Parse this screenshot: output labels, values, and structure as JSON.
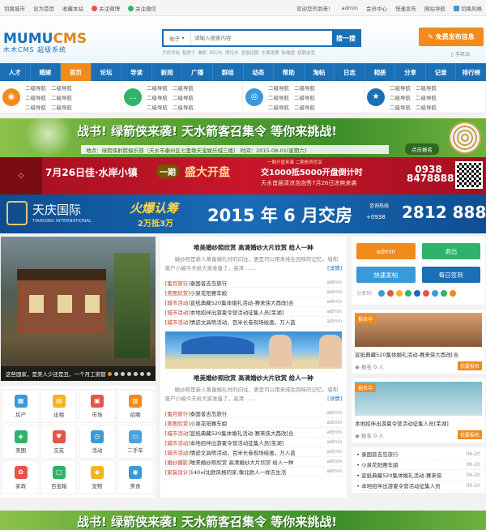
{
  "topbar": {
    "left": [
      "切换城市",
      "设为首页",
      "收藏本站",
      "关注微博",
      "关注微信"
    ],
    "right": [
      "欢迎您的到来！",
      "admin",
      "会员中心",
      "快速发布",
      "网站导航",
      "切换风格"
    ]
  },
  "logo": {
    "line1a": "MUMU",
    "line1b": "CMS",
    "line2": "木木CMS 超级系统"
  },
  "search": {
    "select": "帖子",
    "placeholder": "请输入搜索内容",
    "button": "搜一搜",
    "hotwords": [
      "手机号码",
      "租房子",
      "兼职",
      "四行车",
      "摩托车",
      "急售招聘",
      "车票退票",
      "新楼盘",
      "招聘信息"
    ]
  },
  "publish": {
    "button": "免费发布信息",
    "mobile": "手机站"
  },
  "nav": [
    "人才",
    "婚嫁",
    "首页",
    "论坛",
    "导读",
    "新闻",
    "广播",
    "群组",
    "动态",
    "帮助",
    "淘帖",
    "日志",
    "相册",
    "分享",
    "记录",
    "排行榜"
  ],
  "nav_active": "首页",
  "cats": [
    {
      "icon": "map-pin-icon",
      "color": "#f08b1c",
      "glyph": "◉",
      "links": [
        "二级导航",
        "二级导航",
        "二级导航",
        "二级导航",
        "二级导航",
        "二级导航"
      ]
    },
    {
      "icon": "chat-icon",
      "color": "#2fb36b",
      "glyph": "…",
      "links": [
        "二级导航",
        "二级导航",
        "二级导航",
        "二级导航",
        "二级导航",
        "二级导航"
      ]
    },
    {
      "icon": "camera-icon",
      "color": "#3a9ad9",
      "glyph": "◎",
      "links": [
        "二级导航",
        "二级导航",
        "二级导航",
        "二级导航",
        "二级导航",
        "二级导航"
      ]
    },
    {
      "icon": "star-icon",
      "color": "#1a6fb5",
      "glyph": "★",
      "links": [
        "二级导航",
        "二级导航",
        "二级导航",
        "二级导航",
        "二级导航",
        "二级导航"
      ]
    }
  ],
  "banners": {
    "b1": {
      "title": "战书! 绿箭侠来袭! 天水箭客召集令 等你来挑战!",
      "info": "地点：绿箭侠射箭俱乐部（天水市秦州区七里墩天宝娱乐城三楼） 时间：2015-08-01(星期六)",
      "btn": "点击报名"
    },
    "b2": {
      "a": "7月26日佳·水岸小镇",
      "b": "一期",
      "c": "盛大开盘",
      "d": "交1000抵5000开盘倒计时",
      "e": "天水首届清凉泡泡秀7月26日凉爽来袭",
      "phone": "0938 8478888",
      "pre": "一期开盘来袭 二期贵宾优享"
    },
    "b3": {
      "a": "天庆国际",
      "a2": "TIANQING INTERNATIONAL",
      "b": "火爆认筹",
      "b2": "2万抵3万",
      "c": "2015 年 6 月交房",
      "tel_label": "咨询热线",
      "tel": "2812 888",
      "tel_pre": "+0938"
    }
  },
  "slider": {
    "caption": "这些国家，是美人少还是丑，一个月工资都",
    "dots": 7
  },
  "icons": [
    {
      "name": "fangchan-icon",
      "label": "房产",
      "color": "#3a9ad9",
      "g": "▦"
    },
    {
      "name": "chuzu-icon",
      "label": "出租",
      "color": "#f5b323",
      "g": "▤"
    },
    {
      "name": "shichang-icon",
      "label": "市场",
      "color": "#e8534a",
      "g": "▣"
    },
    {
      "name": "zhaopin-icon",
      "label": "招聘",
      "color": "#f08b1c",
      "g": "▥"
    },
    {
      "name": "meitu-icon",
      "label": "美图",
      "color": "#2fb36b",
      "g": "◈"
    },
    {
      "name": "jiaoyou-icon",
      "label": "交友",
      "color": "#e8534a",
      "g": "♥"
    },
    {
      "name": "huodong-icon",
      "label": "活动",
      "color": "#3a9ad9",
      "g": "◷"
    },
    {
      "name": "ershouche-icon",
      "label": "二手车",
      "color": "#4aa3df",
      "g": "▭"
    },
    {
      "name": "jiazheng-icon",
      "label": "家政",
      "color": "#e8534a",
      "g": "✿"
    },
    {
      "name": "baibaike-icon",
      "label": "百宝箱",
      "color": "#2fb36b",
      "g": "▢"
    },
    {
      "name": "chongwu-icon",
      "label": "宠物",
      "color": "#f5b323",
      "g": "◆"
    },
    {
      "name": "meishi-icon",
      "label": "美食",
      "color": "#3a9ad9",
      "g": "◉"
    }
  ],
  "news": [
    {
      "title": "唯美婚纱照欣赏 高清婚纱大片欣赏 给人一种",
      "desc": "婚纱照是新人筹备婚礼时的向往，更是可以用来纯生回味的记忆。墙和窗户小编今天给大家准备了，高清 ……",
      "more": "[详情]",
      "items": [
        {
          "tag": "[蜜月旅行]",
          "t": "泰国普吉岛旅行",
          "u": "admin"
        },
        {
          "tag": "[美图欣赏]",
          "t": "小泉花阳赛车娘",
          "u": "admin"
        },
        {
          "tag": "[城市活动]",
          "t": "宣纸典藏520集体婚礼活动-赛来侠大酉改[合",
          "u": "admin"
        },
        {
          "tag": "[城市活动]",
          "t": "本地招伴出游夏令营活动征集人员[芜湖]",
          "u": "admin"
        },
        {
          "tag": "[城市活动]",
          "t": "情迹文具喷活动，百米长卷现场绘画，万人蓝",
          "u": "admin"
        }
      ]
    },
    {
      "title": "唯美婚纱照欣赏 高清婚纱大片欣赏 给人一种",
      "desc": "婚纱照是新人筹备婚礼时的向往，更是可以用来纯生回味的记忆。墙和窗户小编今天给大家准备了，高清 ……",
      "more": "[详情]",
      "items": [
        {
          "tag": "[蜜月旅行]",
          "t": "泰国普吉岛旅行",
          "u": "admin"
        },
        {
          "tag": "[美图欣赏]",
          "t": "小泉花阳赛车娘",
          "u": "admin"
        },
        {
          "tag": "[城市活动]",
          "t": "宣纸典藏520集体婚礼活动-赛来侠大酉改[合",
          "u": "admin"
        },
        {
          "tag": "[城市活动]",
          "t": "本地招伴出游夏令营活动征集人员[芜湖]",
          "u": "admin"
        },
        {
          "tag": "[城市活动]",
          "t": "情迹文具喷活动，百米长卷现场绘画，万人蓝",
          "u": "admin"
        },
        {
          "tag": "[婚纱摄影]",
          "t": "唯美婚纱照欣赏 高清婚纱大片欣赏 给人一种",
          "u": "admin"
        },
        {
          "tag": "[家装设计]",
          "t": "140㎡北欧风格的家,像北欧人一样去生活",
          "u": "admin"
        }
      ]
    }
  ],
  "user": {
    "name": "admin",
    "logout": "退出",
    "post": "快速发帖",
    "sign": "每日签到",
    "share_label": "分享到："
  },
  "cards": [
    {
      "tag": "报名中",
      "title": "宣纸典藏520集体婚礼活动-赛来侠大酉改[合",
      "count_label": "报名",
      "count": "0",
      "unit": "人",
      "btn": "我要报名"
    },
    {
      "tag": "报名中",
      "title": "本地招伴出游夏令营活动征集人员[芜湖]",
      "count_label": "报名",
      "count": "0",
      "unit": "人",
      "btn": "我要报名"
    }
  ],
  "side_list": [
    {
      "t": "泰国普吉岛旅行",
      "d": "06-20"
    },
    {
      "t": "小泉花阳赛车娘",
      "d": "06-20"
    },
    {
      "t": "宣纸典藏520集体婚礼活动-赛来侠",
      "d": "06-20"
    },
    {
      "t": "本地招伴出游夏令营活动征集人员",
      "d": "06-20"
    }
  ]
}
